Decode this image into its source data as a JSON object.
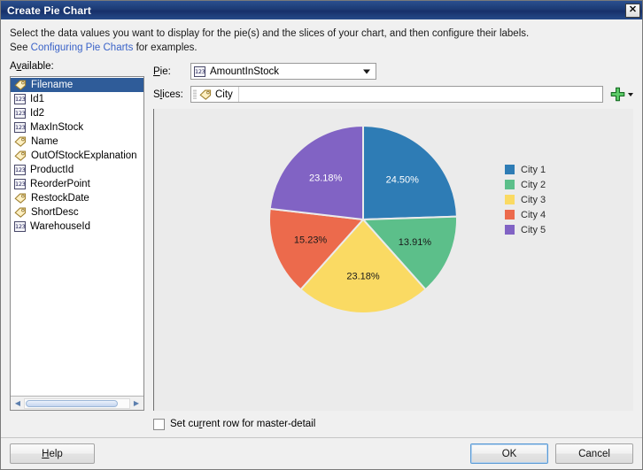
{
  "window": {
    "title": "Create Pie Chart",
    "close_icon": "close-icon",
    "close_label": "✕"
  },
  "instructions": {
    "line1": "Select the data values you want to display for the pie(s) and the slices of your chart, and then configure their labels.",
    "line2_prefix": "See ",
    "link": "Configuring Pie Charts",
    "line2_suffix": " for examples."
  },
  "available": {
    "label": "Available:",
    "items": [
      {
        "label": "Filename",
        "icon": "tag-icon",
        "type": "string",
        "selected": true
      },
      {
        "label": "Id1",
        "icon": "numeric-icon",
        "type": "number",
        "selected": false
      },
      {
        "label": "Id2",
        "icon": "numeric-icon",
        "type": "number",
        "selected": false
      },
      {
        "label": "MaxInStock",
        "icon": "numeric-icon",
        "type": "number",
        "selected": false
      },
      {
        "label": "Name",
        "icon": "tag-icon",
        "type": "string",
        "selected": false
      },
      {
        "label": "OutOfStockExplanation",
        "icon": "tag-icon",
        "type": "string",
        "selected": false
      },
      {
        "label": "ProductId",
        "icon": "numeric-icon",
        "type": "number",
        "selected": false
      },
      {
        "label": "ReorderPoint",
        "icon": "numeric-icon",
        "type": "number",
        "selected": false
      },
      {
        "label": "RestockDate",
        "icon": "tag-icon",
        "type": "string",
        "selected": false
      },
      {
        "label": "ShortDesc",
        "icon": "tag-icon",
        "type": "string",
        "selected": false
      },
      {
        "label": "WarehouseId",
        "icon": "numeric-icon",
        "type": "number",
        "selected": false
      }
    ],
    "numeric_glyph": "123",
    "scroll_left_glyph": "◀",
    "scroll_right_glyph": "▶"
  },
  "fields": {
    "pie_label": "Pie:",
    "pie_value": "AmountInStock",
    "pie_icon": "numeric-icon",
    "slices_label": "Slices:",
    "slices_chips": [
      {
        "label": "City",
        "icon": "tag-icon"
      }
    ],
    "add_icon": "plus-icon",
    "add_dropdown_icon": "chevron-down-icon"
  },
  "checkbox": {
    "label_before": "Set cu",
    "label_mnemonic": "r",
    "label_after": "rent row for master-detail",
    "checked": false
  },
  "footer": {
    "help": "Help",
    "help_mnemonic": "H",
    "ok": "OK",
    "cancel": "Cancel"
  },
  "chart_data": {
    "type": "pie",
    "title": "",
    "labels": [
      "City 1",
      "City 2",
      "City 3",
      "City 4",
      "City 5"
    ],
    "values": [
      24.5,
      13.91,
      23.18,
      15.23,
      23.18
    ],
    "value_labels": [
      "24.50%",
      "13.91%",
      "23.18%",
      "15.23%",
      "23.18%"
    ],
    "colors": [
      "#2e7cb5",
      "#5cbf8a",
      "#fada63",
      "#ec6a4c",
      "#8163c4"
    ],
    "legend_position": "right",
    "background": "#ebebeb",
    "start_angle_deg": 0,
    "label_colors": [
      "#ffffff",
      "#1a1a1a",
      "#1a1a1a",
      "#1a1a1a",
      "#ffffff"
    ]
  }
}
